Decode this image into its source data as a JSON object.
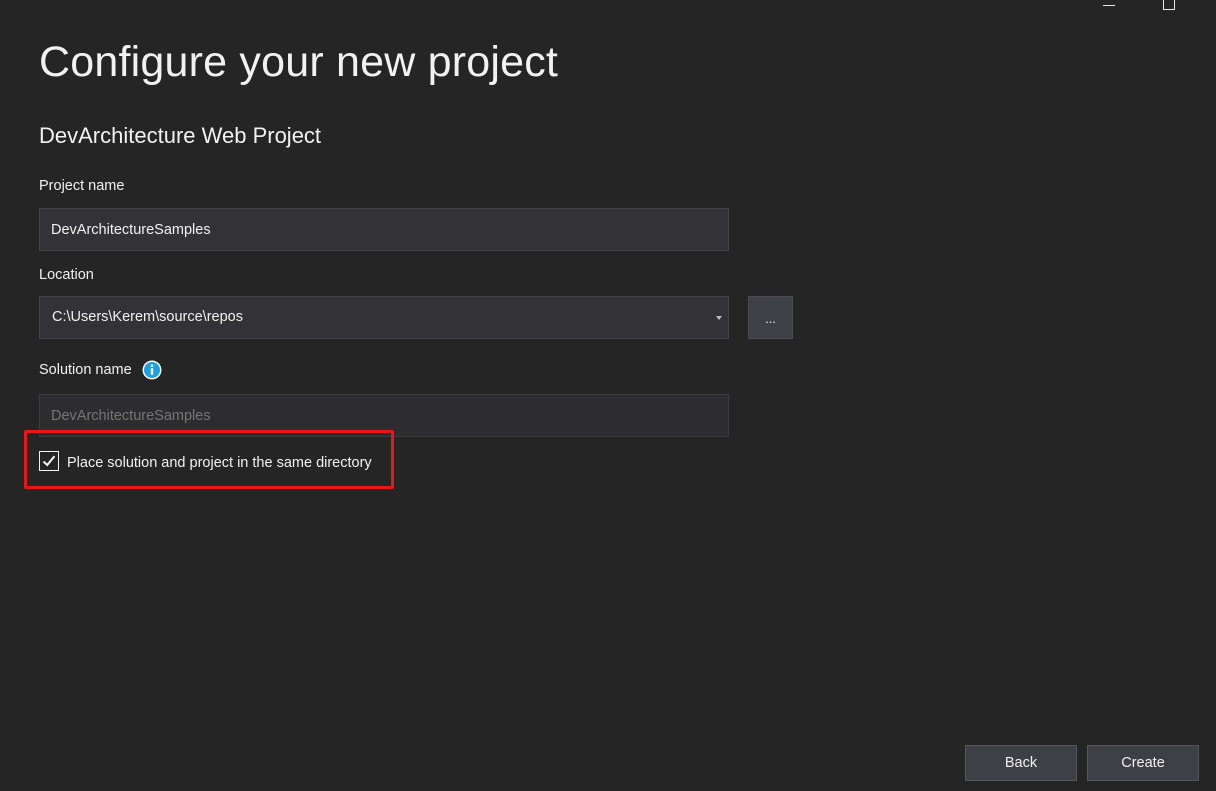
{
  "window": {
    "controls": [
      "minimize-icon",
      "maximize-icon"
    ]
  },
  "header": {
    "title": "Configure your new project",
    "template_name": "DevArchitecture Web Project"
  },
  "form": {
    "project_name": {
      "label": "Project name",
      "value": "DevArchitectureSamples"
    },
    "location": {
      "label": "Location",
      "value": "C:\\Users\\Kerem\\source\\repos",
      "browse_label": "..."
    },
    "solution_name": {
      "label": "Solution name",
      "placeholder": "DevArchitectureSamples",
      "info_icon": "info-icon",
      "disabled": true
    },
    "same_directory": {
      "label": "Place solution and project in the same directory",
      "checked": true
    }
  },
  "annotation": {
    "highlight_color": "#e8151b"
  },
  "footer": {
    "back_label": "Back",
    "create_label": "Create"
  },
  "colors": {
    "background": "#252526",
    "input_background": "#333337",
    "button_background": "#3f3f46",
    "info_blue": "#1ba1e2"
  }
}
